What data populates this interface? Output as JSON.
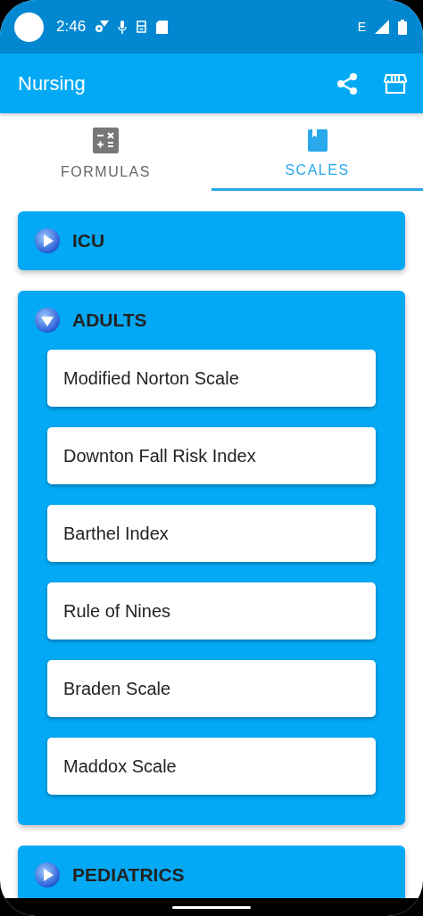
{
  "status_bar": {
    "time": "2:46",
    "network": "E"
  },
  "app_bar": {
    "title": "Nursing"
  },
  "tabs": [
    {
      "label": "FORMULAS",
      "kind": "calculator",
      "selected": false
    },
    {
      "label": "SCALES",
      "kind": "book",
      "selected": true
    }
  ],
  "sections": [
    {
      "title": "ICU",
      "expanded": false
    },
    {
      "title": "ADULTS",
      "expanded": true,
      "items": [
        "Modified Norton Scale",
        "Downton Fall Risk Index",
        "Barthel Index",
        "Rule of Nines",
        "Braden Scale",
        "Maddox Scale"
      ]
    },
    {
      "title": "PEDIATRICS",
      "expanded": false
    }
  ]
}
